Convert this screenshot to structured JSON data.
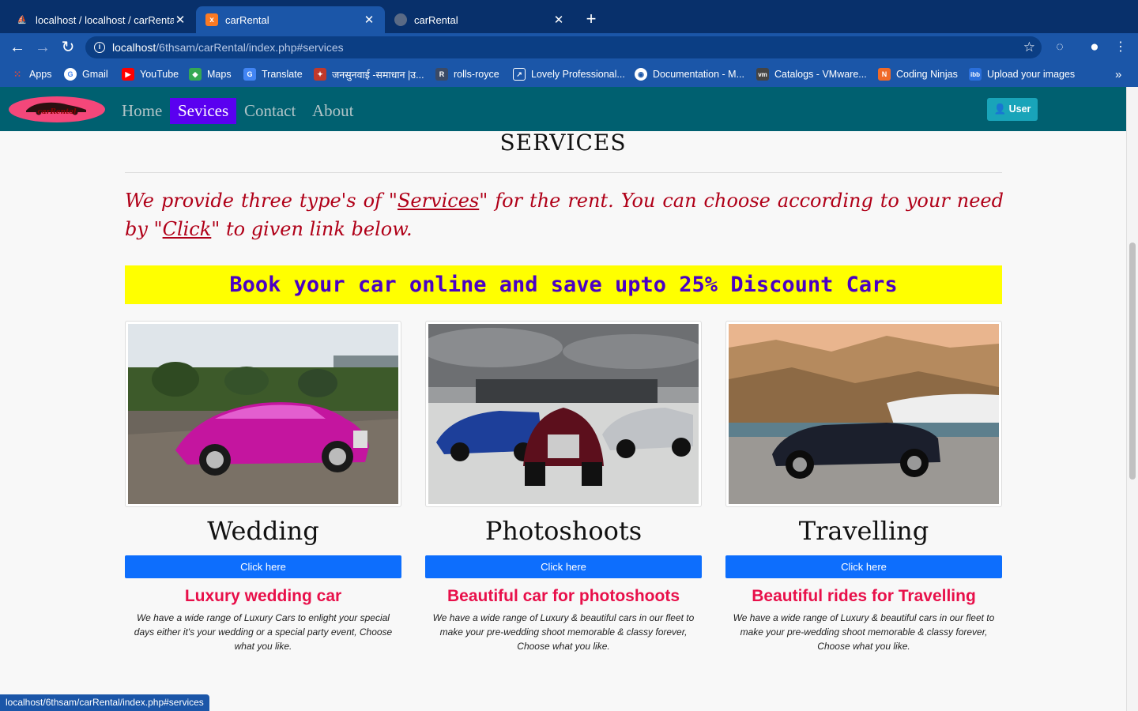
{
  "browser": {
    "tabs": [
      {
        "title": "localhost / localhost / carRental / c",
        "icon": "phpmyadmin-icon",
        "active": false
      },
      {
        "title": "carRental",
        "icon": "xampp-icon",
        "active": true
      },
      {
        "title": "carRental",
        "icon": "globe-icon",
        "active": false
      }
    ],
    "url_host": "localhost",
    "url_path": "/6thsam/carRental/index.php#services",
    "bookmarks": [
      {
        "label": "Apps",
        "icon": "apps-grid-icon",
        "color": "#e04a3a"
      },
      {
        "label": "Gmail",
        "icon": "google-icon",
        "color": "#ffffff"
      },
      {
        "label": "YouTube",
        "icon": "youtube-icon",
        "color": "#ff0000"
      },
      {
        "label": "Maps",
        "icon": "maps-icon",
        "color": "#34a853"
      },
      {
        "label": "Translate",
        "icon": "translate-icon",
        "color": "#4285f4"
      },
      {
        "label": "जनसुनवाई -समाधान |उ...",
        "icon": "emblem-icon",
        "color": "#c0392b"
      },
      {
        "label": "rolls-royce",
        "icon": "rolls-royce-icon",
        "color": "#3b4a66"
      },
      {
        "label": "Lovely Professional...",
        "icon": "external-link-icon",
        "color": "#1b56a8"
      },
      {
        "label": "Documentation - M...",
        "icon": "chrome-icon",
        "color": "#ffffff"
      },
      {
        "label": "Catalogs - VMware...",
        "icon": "vmware-icon",
        "color": "#444444"
      },
      {
        "label": "Coding Ninjas",
        "icon": "coding-ninjas-icon",
        "color": "#f06a28"
      },
      {
        "label": "Upload your images",
        "icon": "imgbb-icon",
        "color": "#2a6fdb"
      }
    ],
    "overflow": "»",
    "status_url": "localhost/6thsam/carRental/index.php#services"
  },
  "site": {
    "logo_text": "carRental",
    "nav": [
      {
        "label": "Home",
        "active": false
      },
      {
        "label": "Sevices",
        "active": true
      },
      {
        "label": "Contact",
        "active": false
      },
      {
        "label": "About",
        "active": false
      }
    ],
    "user_button": "User",
    "section_title": "SERVICES",
    "intro": {
      "part1": "We provide three type's of \"",
      "link1": "Services",
      "part2": "\" for the rent. You can choose according to your need by \"",
      "link2": "Click",
      "part3": "\" to given link below."
    },
    "promo": "Book your car online and save upto 25% Discount Cars",
    "cards": [
      {
        "title": "Wedding",
        "button": "Click here",
        "subtitle": "Luxury wedding car",
        "description": "We have a wide range of Luxury Cars to enlight your special days either it's your wedding or a special party event, Choose what you like."
      },
      {
        "title": "Photoshoots",
        "button": "Click here",
        "subtitle": "Beautiful car for photoshoots",
        "description": "We have a wide range of Luxury & beautiful cars in our fleet to make your pre-wedding shoot memorable & classy forever, Choose what you like."
      },
      {
        "title": "Travelling",
        "button": "Click here",
        "subtitle": "Beautiful rides for Travelling",
        "description": "We have a wide range of Luxury & beautiful cars in our fleet to make your pre-wedding shoot memorable & classy forever, Choose what you like."
      }
    ]
  },
  "colors": {
    "chrome_dark": "#08306b",
    "chrome": "#1b56a8",
    "site_nav": "#006070",
    "nav_active": "#5a00f0",
    "intro_text": "#b00018",
    "promo_bg": "#ffff00",
    "promo_text": "#4a00c4",
    "button": "#0d6efd",
    "subtitle": "#e8104a"
  }
}
